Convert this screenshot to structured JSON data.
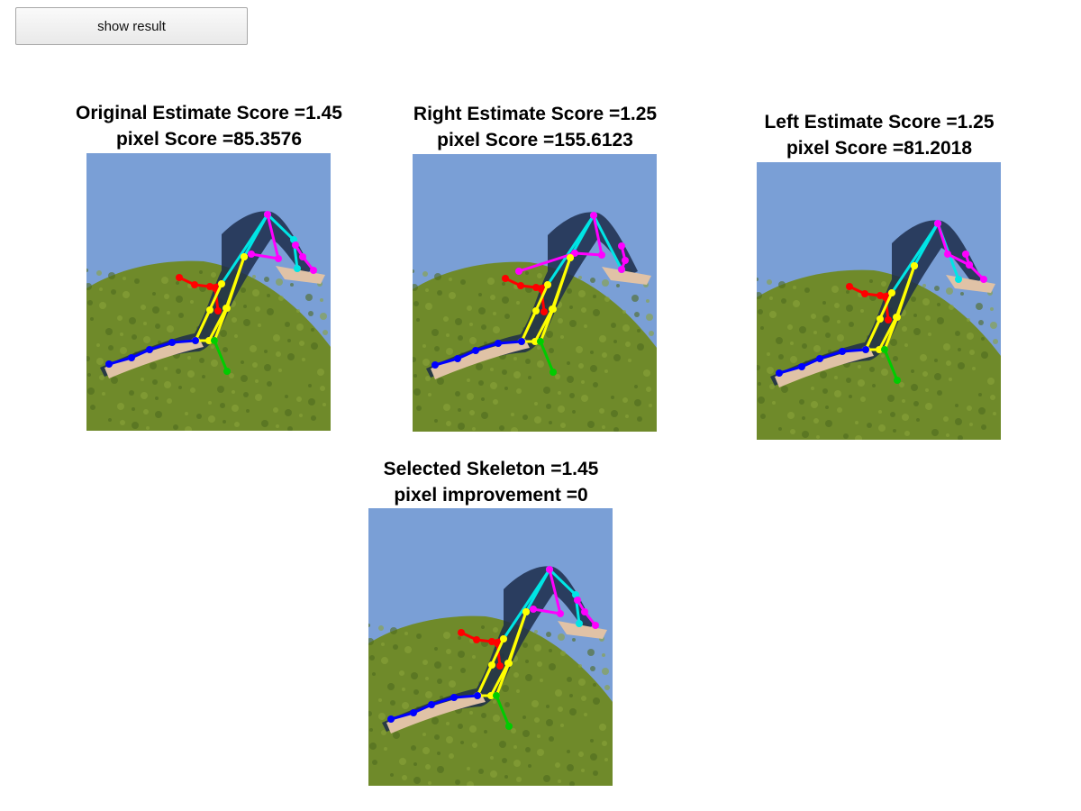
{
  "toolbar": {
    "show_result_label": "show result"
  },
  "panels": [
    {
      "line1": "Original Estimate Score =1.45",
      "line2": "pixel Score =85.3576",
      "skeleton": "original"
    },
    {
      "line1": "Right Estimate Score =1.25",
      "line2": "pixel Score =155.6123",
      "skeleton": "right"
    },
    {
      "line1": "Left Estimate Score =1.25",
      "line2": "pixel Score =81.2018",
      "skeleton": "left"
    },
    {
      "line1": "Selected Skeleton =1.45",
      "line2": "pixel improvement =0",
      "skeleton": "original"
    }
  ],
  "colors": {
    "sky": "#7a9fd6",
    "bush": "#6f8a2a",
    "torso": "#ffff00",
    "head_arm": "#00e5e5",
    "right_arm": "#ff00ff",
    "left_arm": "#ff0000",
    "leg": "#0000ff",
    "foot": "#00cc00"
  }
}
